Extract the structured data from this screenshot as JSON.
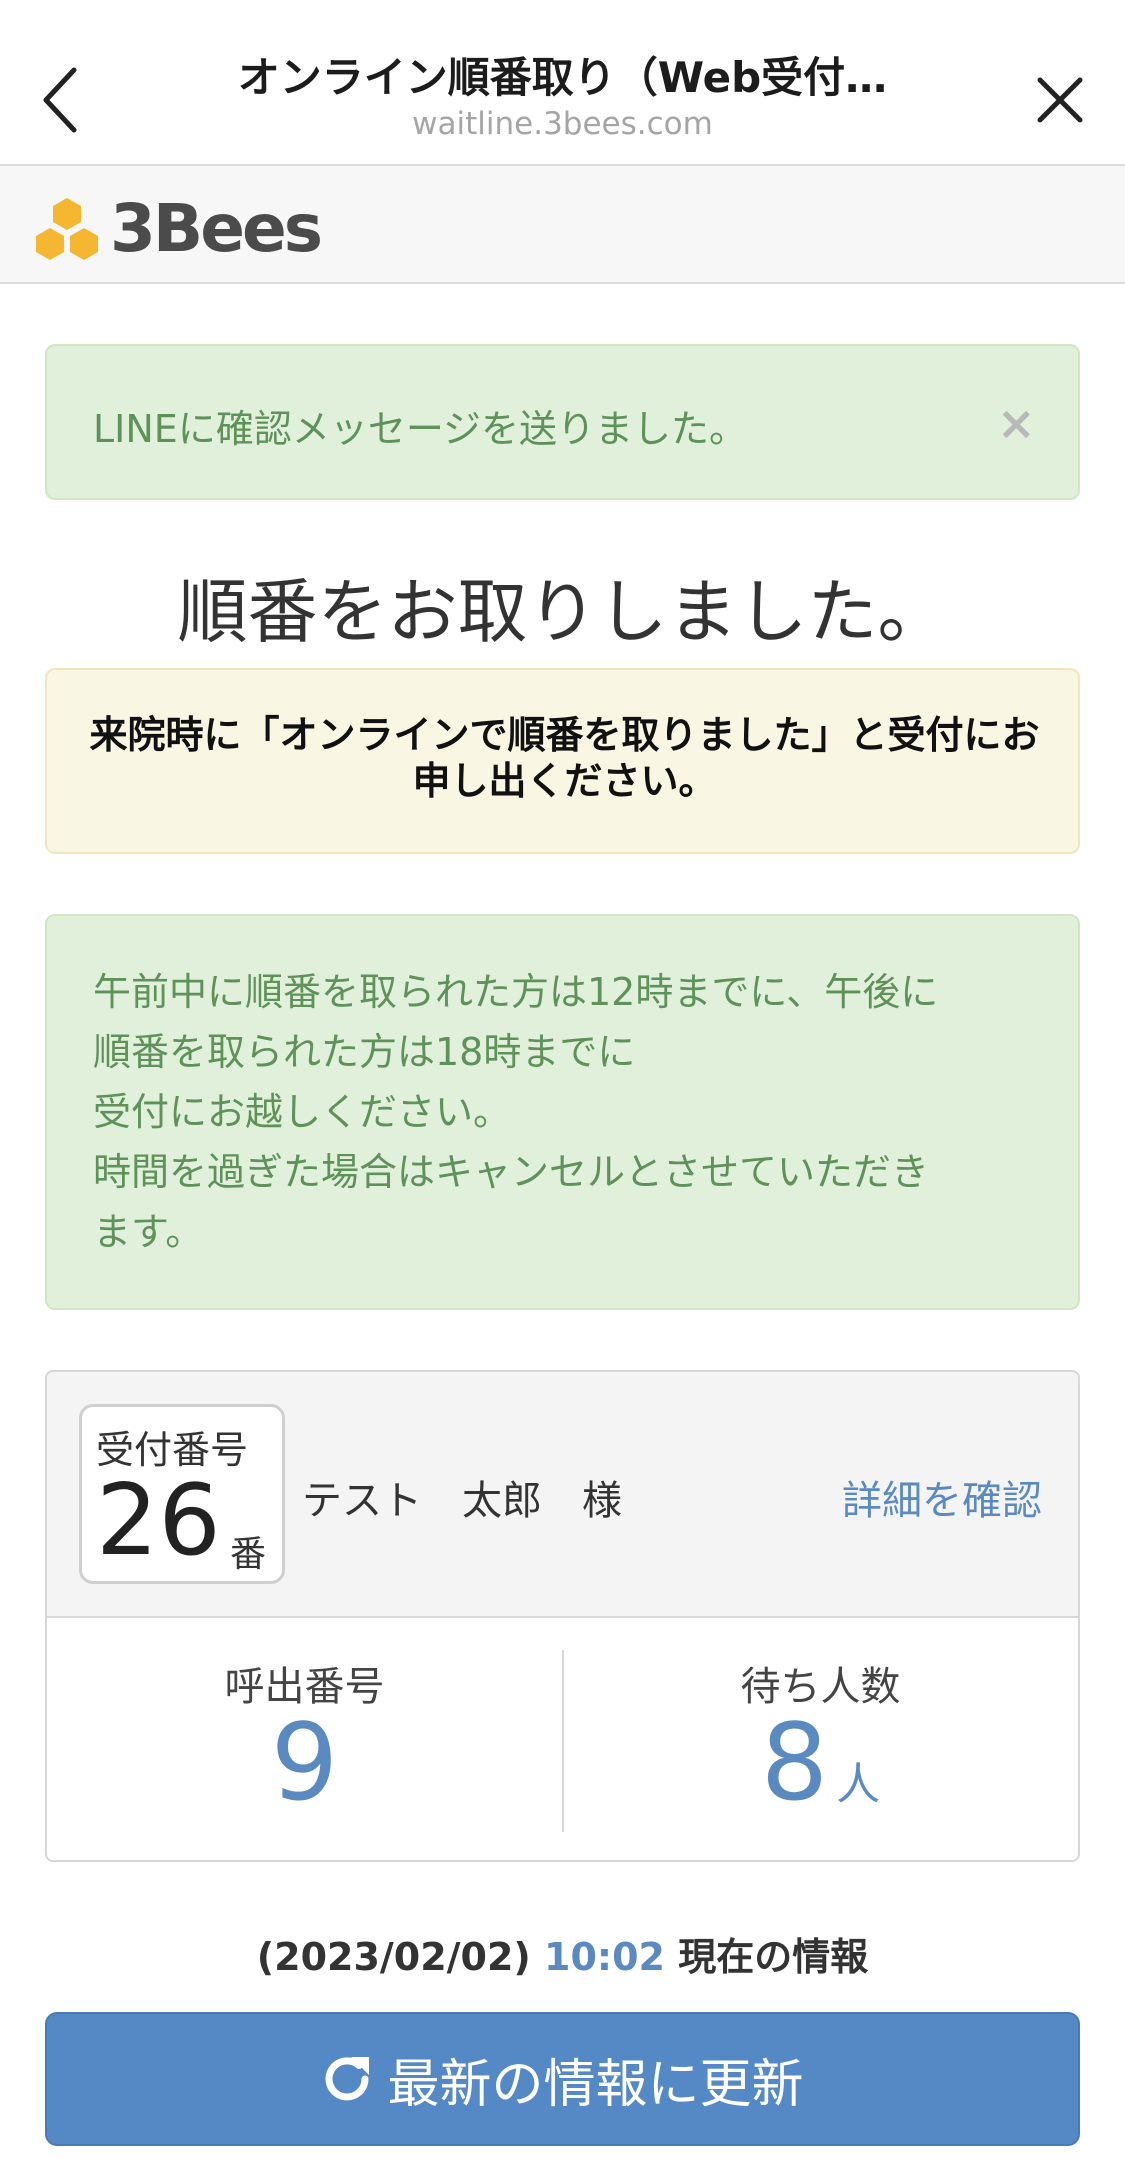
{
  "nav": {
    "title": "オンライン順番取り（Web受付…",
    "url": "waitline.3bees.com"
  },
  "brand": {
    "name": "3Bees",
    "logo_color": "#f5b731"
  },
  "alerts": {
    "line_message": "LINEに確認メッセージを送りました。",
    "close_glyph": "×",
    "notice": "来院時に「オンラインで順番を取りました」と受付にお申し出ください。",
    "info_lines": [
      "午前中に順番を取られた方は12時までに、午後に",
      "順番を取られた方は18時までに",
      "受付にお越しください。",
      "時間を過ぎた場合はキャンセルとさせていただき",
      "ます。"
    ]
  },
  "main_title": "順番をお取りしました。",
  "reception": {
    "label": "受付番号",
    "number": "26",
    "unit": "番",
    "patient_name": "テスト　太郎　様",
    "detail_link": "詳細を確認"
  },
  "stats": {
    "call_label": "呼出番号",
    "call_number": "9",
    "waiting_label": "待ち人数",
    "waiting_count": "8",
    "waiting_unit": "人"
  },
  "timestamp": {
    "date": "(2023/02/02)",
    "time": "10:02",
    "suffix": "現在の情報"
  },
  "refresh_button": {
    "label": "最新の情報に更新"
  },
  "colors": {
    "accent": "#5b8ac0",
    "success_bg": "#e1f0da",
    "success_text": "#5e925a",
    "warning_bg": "#f9f6e4",
    "button_bg": "#5589c6"
  }
}
